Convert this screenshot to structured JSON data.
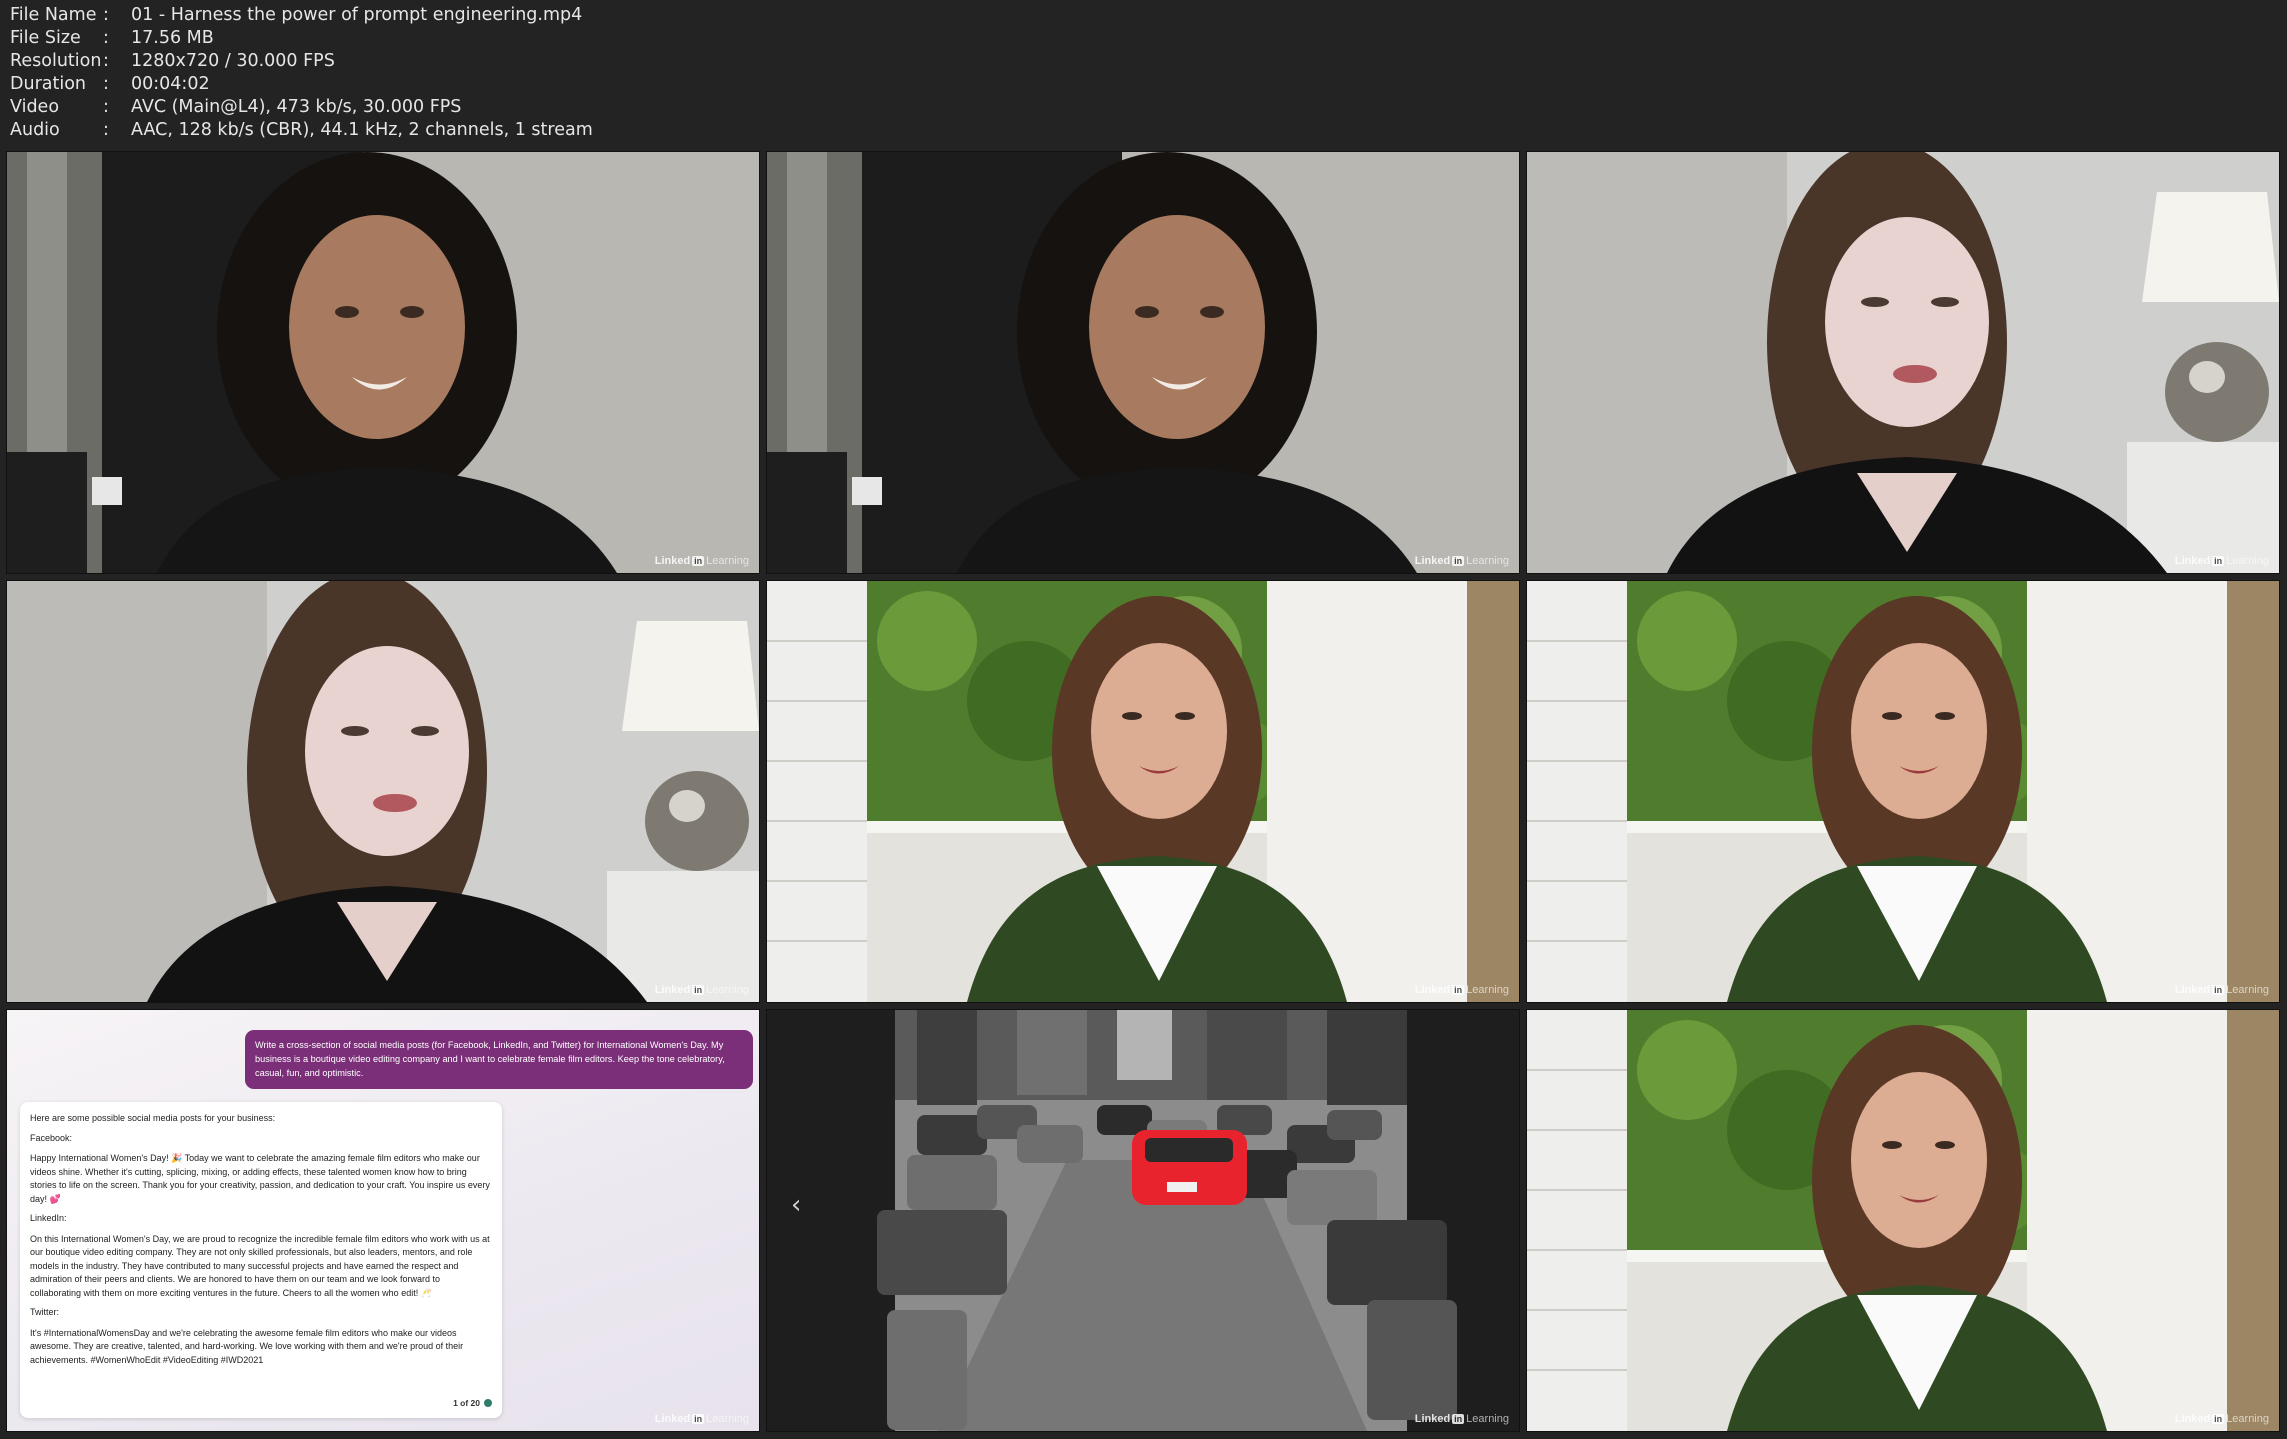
{
  "info": {
    "rows": [
      {
        "key": "File Name",
        "value": "01 - Harness the power of prompt engineering.mp4"
      },
      {
        "key": "File Size",
        "value": "17.56 MB"
      },
      {
        "key": "Resolution",
        "value": "1280x720 / 30.000 FPS"
      },
      {
        "key": "Duration",
        "value": "00:04:02"
      },
      {
        "key": "Video",
        "value": "AVC (Main@L4), 473 kb/s, 30.000 FPS"
      },
      {
        "key": "Audio",
        "value": "AAC, 128 kb/s (CBR), 44.1 kHz, 2 channels, 1 stream"
      }
    ],
    "separator": ":"
  },
  "watermark": {
    "linked": "Linked",
    "in": "in",
    "learning": "Learning"
  },
  "chat": {
    "prompt": "Write a cross-section of social media posts (for Facebook, LinkedIn, and Twitter) for International Women's Day. My business is a boutique video editing company and I want to celebrate female film editors. Keep the tone celebratory, casual, fun, and optimistic.",
    "intro": "Here are some possible social media posts for your business:",
    "fb_head": "Facebook:",
    "fb_body": "Happy International Women's Day! 🎉 Today we want to celebrate the amazing female film editors who make our videos shine. Whether it's cutting, splicing, mixing, or adding effects, these talented women know how to bring stories to life on the screen. Thank you for your creativity, passion, and dedication to your craft. You inspire us every day! 💕",
    "li_head": "LinkedIn:",
    "li_body": "On this International Women's Day, we are proud to recognize the incredible female film editors who work with us at our boutique video editing company. They are not only skilled professionals, but also leaders, mentors, and role models in the industry. They have contributed to many successful projects and have earned the respect and admiration of their peers and clients. We are honored to have them on our team and we look forward to collaborating with them on more exciting ventures in the future. Cheers to all the women who edit! 🥂",
    "tw_head": "Twitter:",
    "tw_body": "It's #InternationalWomensDay and we're celebrating the awesome female film editors who make our videos awesome. They are creative, talented, and hard-working. We love working with them and we're proud of their achievements. #WomenWhoEdit #VideoEditing #IWD2021",
    "pager": "1 of 20"
  },
  "colors": {
    "background": "#232323",
    "info_text": "#e6e6e6",
    "prompt_bubble": "#7b2f79",
    "red_car": "#e8232d",
    "cardigan": "#2f4a22"
  },
  "icons": {
    "prev": "chevron-left-icon",
    "linkedin": "linkedin-logo-icon"
  }
}
